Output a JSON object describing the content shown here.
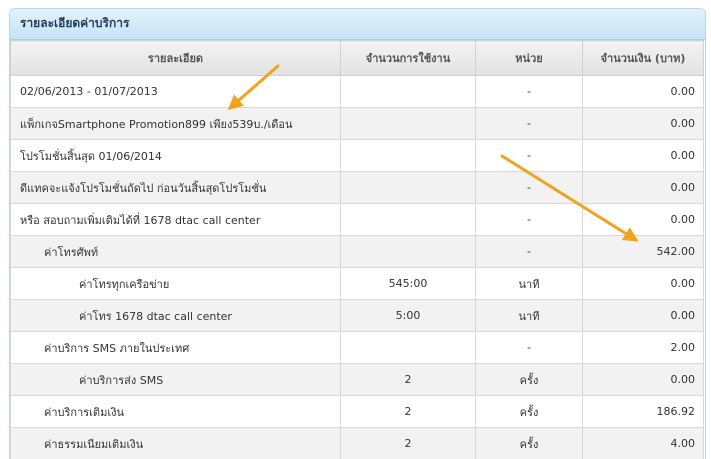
{
  "panel": {
    "title": "รายละเอียดค่าบริการ"
  },
  "columns": [
    "รายละเอียด",
    "จำนวนการใช้งาน",
    "หน่วย",
    "จำนวนเงิน (บาท)"
  ],
  "rows": [
    {
      "detail": "02/06/2013 - 01/07/2013",
      "usage": "",
      "unit": "-",
      "amount": "0.00",
      "level": 0
    },
    {
      "detail": "แพ็กเกจSmartphone Promotion899 เพียง539บ./เดือน",
      "usage": "",
      "unit": "-",
      "amount": "0.00",
      "level": 0
    },
    {
      "detail": "โปรโมชั่นสิ้นสุด 01/06/2014",
      "usage": "",
      "unit": "-",
      "amount": "0.00",
      "level": 0
    },
    {
      "detail": "ดีแทคจะแจ้งโปรโมชั่นถัดไป ก่อนวันสิ้นสุดโปรโมชั่น",
      "usage": "",
      "unit": "-",
      "amount": "0.00",
      "level": 0
    },
    {
      "detail": "หรือ สอบถามเพิ่มเติมได้ที่ 1678 dtac call center",
      "usage": "",
      "unit": "-",
      "amount": "0.00",
      "level": 0
    },
    {
      "detail": "ค่าโทรศัพท์",
      "usage": "",
      "unit": "-",
      "amount": "542.00",
      "level": 1
    },
    {
      "detail": "ค่าโทรทุกเครือข่าย",
      "usage": "545:00",
      "unit": "นาที",
      "amount": "0.00",
      "level": 2
    },
    {
      "detail": "ค่าโทร 1678 dtac call center",
      "usage": "5:00",
      "unit": "นาที",
      "amount": "0.00",
      "level": 2
    },
    {
      "detail": "ค่าบริการ SMS ภายในประเทศ",
      "usage": "",
      "unit": "-",
      "amount": "2.00",
      "level": 1
    },
    {
      "detail": "ค่าบริการส่ง SMS",
      "usage": "2",
      "unit": "ครั้ง",
      "amount": "0.00",
      "level": 2
    },
    {
      "detail": "ค่าบริการเติมเงิน",
      "usage": "2",
      "unit": "ครั้ง",
      "amount": "186.92",
      "level": 1
    },
    {
      "detail": "ค่าธรรมเนียมเติมเงิน",
      "usage": "2",
      "unit": "ครั้ง",
      "amount": "4.00",
      "level": 1
    }
  ],
  "colors": {
    "header_bg": "#c6e2f4",
    "row_alt": "#f2f2f2",
    "annotation_arrow": "#f5a21b"
  }
}
